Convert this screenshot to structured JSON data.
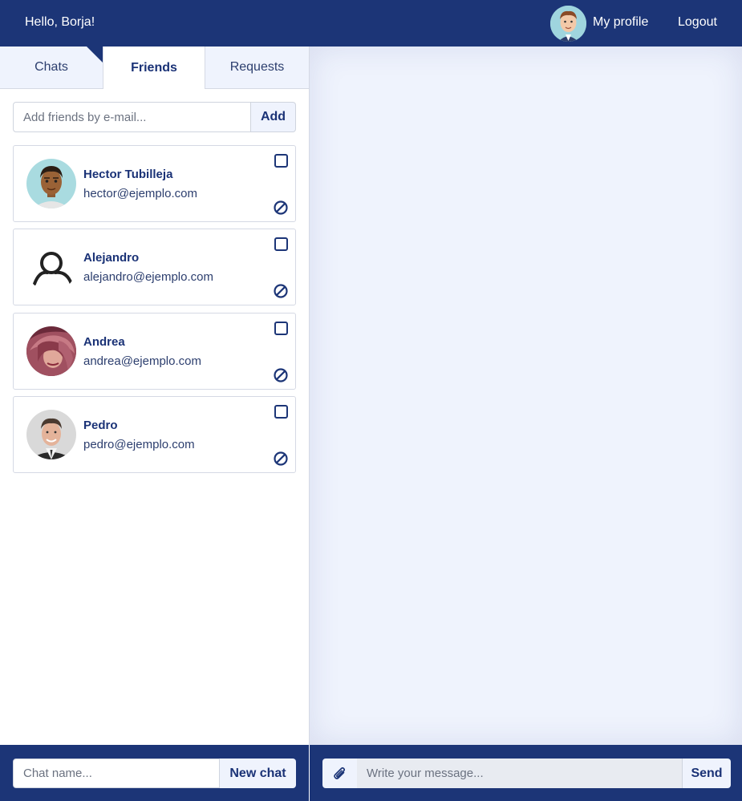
{
  "header": {
    "greeting": "Hello, Borja!",
    "profile_label": "My profile",
    "logout_label": "Logout",
    "profile_avatar_icon": "user-avatar-cartoon"
  },
  "sidebar": {
    "tabs": [
      {
        "label": "Chats",
        "active": false
      },
      {
        "label": "Friends",
        "active": true
      },
      {
        "label": "Requests",
        "active": false
      }
    ],
    "add_friend": {
      "placeholder": "Add friends by e-mail...",
      "button_label": "Add"
    },
    "friends": [
      {
        "name": "Hector Tubilleja",
        "email": "hector@ejemplo.com",
        "avatar": "cartoon-man-avatar"
      },
      {
        "name": "Alejandro",
        "email": "alejandro@ejemplo.com",
        "avatar": "generic-user-icon"
      },
      {
        "name": "Andrea",
        "email": "andrea@ejemplo.com",
        "avatar": "photo-woman-avatar"
      },
      {
        "name": "Pedro",
        "email": "pedro@ejemplo.com",
        "avatar": "photo-man-suit-avatar"
      }
    ]
  },
  "bottom_left": {
    "chat_name_placeholder": "Chat name...",
    "new_chat_label": "New chat"
  },
  "bottom_right": {
    "message_placeholder": "Write your message...",
    "send_label": "Send",
    "attach_icon": "paperclip-icon"
  },
  "colors": {
    "primary": "#1c3577",
    "light_bg": "#eff3fd",
    "border": "#d5d9e4"
  }
}
